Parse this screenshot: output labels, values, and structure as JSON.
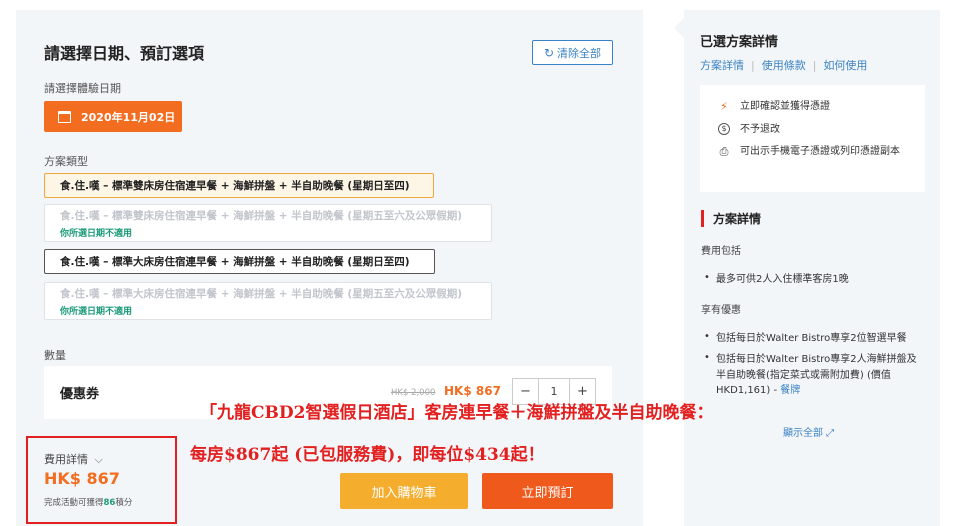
{
  "booking": {
    "title": "請選擇日期、預訂選項",
    "clear_label": "清除全部",
    "date_label": "請選擇體驗日期",
    "date_value": "2020年11月02日",
    "plan_label": "方案類型",
    "plans": [
      {
        "name": "食.住.嘆 – 標準雙床房住宿連早餐 + 海鮮拼盤 + 半自助晚餐 (星期日至四)",
        "note": ""
      },
      {
        "name": "食.住.嘆 – 標準雙床房住宿連早餐 + 海鮮拼盤 + 半自助晚餐 (星期五至六及公眾假期)",
        "note": "你所選日期不適用"
      },
      {
        "name": "食.住.嘆 – 標準大床房住宿連早餐 + 海鮮拼盤 + 半自助晚餐 (星期日至四)",
        "note": ""
      },
      {
        "name": "食.住.嘆 – 標準大床房住宿連早餐 + 海鮮拼盤 + 半自助晚餐 (星期五至六及公眾假期)",
        "note": "你所選日期不適用"
      }
    ],
    "qty_label": "數量",
    "ticket": {
      "name": "優惠券",
      "old_price": "HK$ 2,000",
      "price": "HK$ 867",
      "minus": "−",
      "qty": "1",
      "plus": "+"
    },
    "fee": {
      "label": "費用詳情",
      "chevron": "⌵",
      "price": "HK$ 867",
      "note_pre": "完成活動可獲得",
      "points": "86",
      "note_post": "積分"
    },
    "cart_label": "加入購物車",
    "book_label": "立即預訂"
  },
  "overlay": {
    "line1": "「九龍CBD2智選假日酒店」客房連早餐＋海鮮拼盤及半自助晚餐：",
    "line2": "每房$867起 (已包服務費)，即每位$434起！"
  },
  "details": {
    "title": "已選方案詳情",
    "links": [
      "方案詳情",
      "使用條款",
      "如何使用"
    ],
    "features": [
      {
        "icon": "bolt-icon",
        "glyph": "⚡",
        "text": "立即確認並獲得憑證"
      },
      {
        "icon": "refund-icon",
        "glyph": "$",
        "text": "不予退改"
      },
      {
        "icon": "printer-icon",
        "glyph": "⎙",
        "text": "可出示手機電子憑證或列印憑證副本"
      }
    ],
    "section_title": "方案詳情",
    "includes_label": "費用包括",
    "includes": [
      "最多可供2人入住標準客房1晚"
    ],
    "perks_label": "享有優惠",
    "perks": [
      "包括每日於Walter Bistro專享2位智選早餐",
      "包括每日於Walter Bistro專享2人海鮮拼盤及半自助晚餐(指定菜式或需附加費) (價值HKD1,161) - "
    ],
    "menu_link": "餐牌",
    "show_all": "顯示全部 ⤢"
  },
  "colors": {
    "accent": "#f36d21",
    "link": "#3b82c4",
    "highlight": "#e32020",
    "green": "#1b9b7a"
  }
}
